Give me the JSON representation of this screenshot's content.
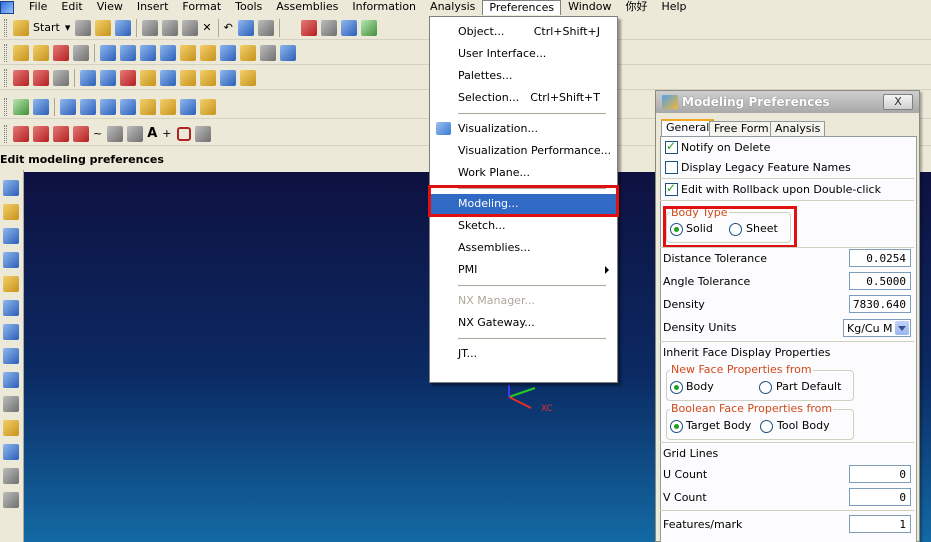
{
  "menubar": {
    "items": [
      "File",
      "Edit",
      "View",
      "Insert",
      "Format",
      "Tools",
      "Assemblies",
      "Information",
      "Analysis",
      "Preferences",
      "Window",
      "你好",
      "Help"
    ],
    "active_index": 9
  },
  "toolbar": {
    "start_label": "Start"
  },
  "statusline": {
    "text": "Edit modeling preferences"
  },
  "viewport": {
    "triad_label": "XC"
  },
  "preferences_menu": {
    "items": [
      {
        "label": "Object...",
        "shortcut": "Ctrl+Shift+J"
      },
      {
        "label": "User Interface...",
        "shortcut": ""
      },
      {
        "label": "Palettes...",
        "shortcut": ""
      },
      {
        "label": "Selection...",
        "shortcut": "Ctrl+Shift+T"
      },
      {
        "label": "Visualization...",
        "shortcut": ""
      },
      {
        "label": "Visualization Performance...",
        "shortcut": ""
      },
      {
        "label": "Work Plane...",
        "shortcut": ""
      },
      {
        "label": "Modeling...",
        "shortcut": ""
      },
      {
        "label": "Sketch...",
        "shortcut": ""
      },
      {
        "label": "Assemblies...",
        "shortcut": ""
      },
      {
        "label": "PMI",
        "shortcut": ""
      },
      {
        "label": "NX Manager...",
        "shortcut": ""
      },
      {
        "label": "NX Gateway...",
        "shortcut": ""
      },
      {
        "label": "JT...",
        "shortcut": ""
      }
    ]
  },
  "dialog": {
    "title": "Modeling Preferences",
    "close_label": "X",
    "tabs": [
      "General",
      "Free Form",
      "Analysis"
    ],
    "notify_on_delete": "Notify on Delete",
    "display_legacy": "Display Legacy Feature Names",
    "edit_rollback": "Edit with Rollback upon Double-click",
    "body_type": {
      "title": "Body Type",
      "solid": "Solid",
      "sheet": "Sheet"
    },
    "distance_tolerance": {
      "label": "Distance Tolerance",
      "value": "0.0254"
    },
    "angle_tolerance": {
      "label": "Angle Tolerance",
      "value": "0.5000"
    },
    "density": {
      "label": "Density",
      "value": "7830.640"
    },
    "density_units": {
      "label": "Density Units",
      "value": "Kg/Cu M"
    },
    "inherit_face": "Inherit Face Display Properties",
    "new_face": {
      "title": "New Face Properties from",
      "body": "Body",
      "part_default": "Part Default"
    },
    "boolean_face": {
      "title": "Boolean Face Properties from",
      "target_body": "Target Body",
      "tool_body": "Tool Body"
    },
    "grid_lines": "Grid Lines",
    "u_count": {
      "label": "U Count",
      "value": "0"
    },
    "v_count": {
      "label": "V Count",
      "value": "0"
    },
    "features_mark": {
      "label": "Features/mark",
      "value": "1"
    }
  },
  "colors": {
    "highlight_box": "#e01010",
    "viewport_top": "#0e1140",
    "viewport_bottom": "#136aa4"
  }
}
